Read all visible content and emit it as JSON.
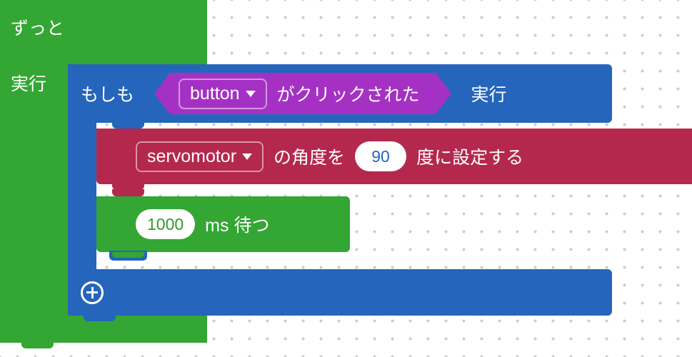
{
  "forever": {
    "title": "ずっと",
    "execute": "実行"
  },
  "if": {
    "label": "もしも",
    "execute": "実行",
    "condition": {
      "dropdown": "button",
      "suffix": "がクリックされた"
    }
  },
  "servo": {
    "dropdown": "servomotor",
    "text1": "の角度を",
    "value": "90",
    "text2": "度に設定する"
  },
  "wait": {
    "value": "1000",
    "text": "ms 待つ"
  }
}
